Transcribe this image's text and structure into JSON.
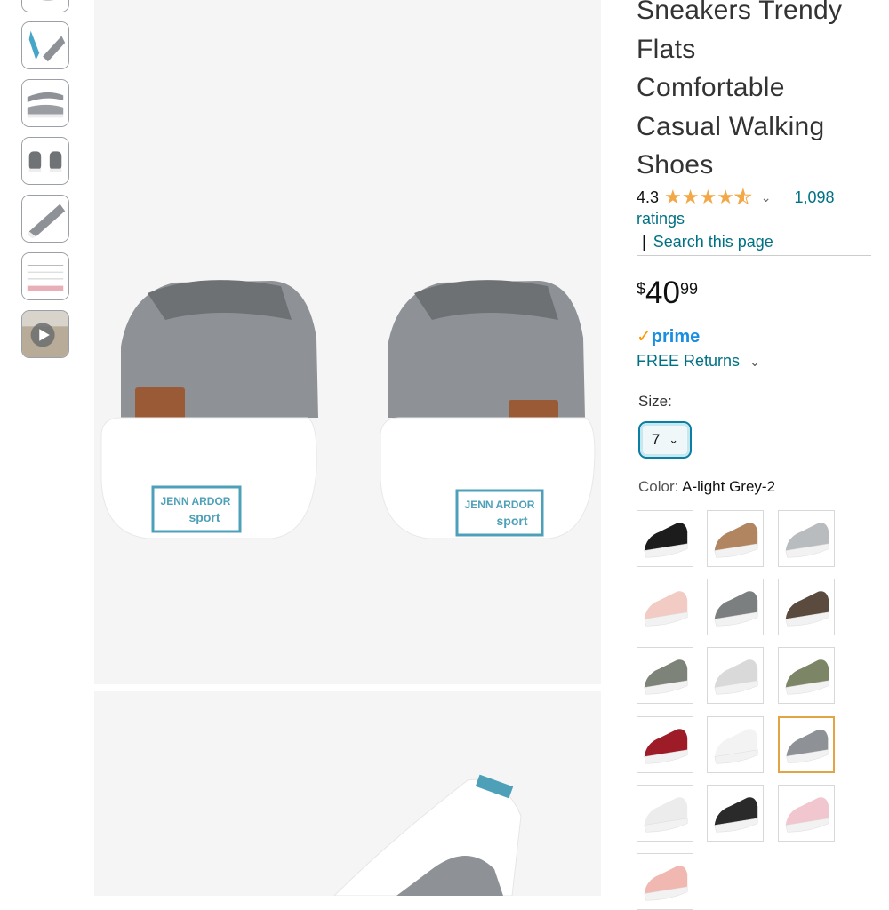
{
  "product": {
    "title_lines": [
      "Sneakers Trendy",
      "Flats",
      "Comfortable",
      "Casual Walking",
      "Shoes"
    ],
    "rating_value": "4.3",
    "ratings_count": "1,098",
    "ratings_label": "ratings",
    "search_link": "Search this page",
    "price_symbol": "$",
    "price_whole": "40",
    "price_fraction": "99",
    "prime_label": "prime",
    "returns_label": "FREE Returns",
    "size_label": "Size:",
    "size_value": "7",
    "color_label": "Color:",
    "color_value": "A-light Grey-2"
  },
  "brand_patch": {
    "line1": "JENN ARDOR",
    "line2": "sport"
  },
  "colors": {
    "accent_link": "#007185",
    "star": "#F3A847",
    "prime_blue": "#1a8ee0",
    "selected_border": "#e3a444",
    "shoe_grey": "#8e9296"
  },
  "swatches": [
    {
      "name": "black",
      "color": "#1c1c1c"
    },
    {
      "name": "leopard",
      "color": "#b08560"
    },
    {
      "name": "light-grey",
      "color": "#b9bcbf"
    },
    {
      "name": "pink",
      "color": "#f2cbc4"
    },
    {
      "name": "grey",
      "color": "#7c7f80"
    },
    {
      "name": "camo-brown",
      "color": "#5a4b3e"
    },
    {
      "name": "grey-green",
      "color": "#7d8378"
    },
    {
      "name": "zebra",
      "color": "#d9d9d9"
    },
    {
      "name": "olive",
      "color": "#7c8667"
    },
    {
      "name": "red",
      "color": "#9e1c28"
    },
    {
      "name": "white",
      "color": "#f3f3f3"
    },
    {
      "name": "light-grey-2",
      "color": "#8e9296"
    },
    {
      "name": "white-2",
      "color": "#ececec"
    },
    {
      "name": "black-2",
      "color": "#2a2a2a"
    },
    {
      "name": "pink-floral",
      "color": "#f1c6cf"
    },
    {
      "name": "floral",
      "color": "#f0b8b0"
    }
  ]
}
